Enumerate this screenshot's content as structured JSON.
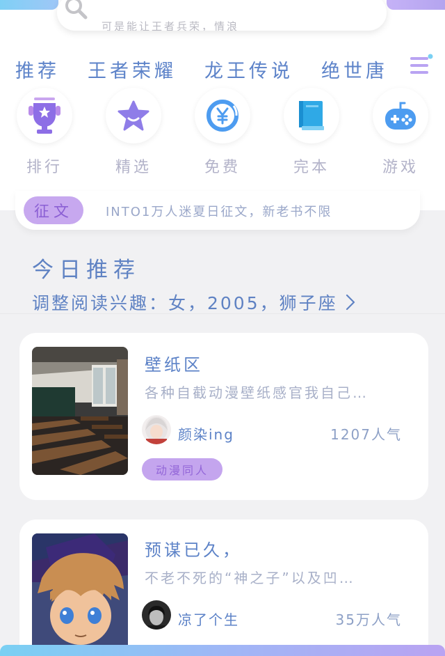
{
  "search": {
    "placeholder": "可是能让王者兵荣，情浪"
  },
  "tabs": [
    "推荐",
    "王者荣耀",
    "龙王传说",
    "绝世唐"
  ],
  "categories": [
    {
      "label": "排行",
      "icon": "trophy-icon"
    },
    {
      "label": "精选",
      "icon": "star-icon"
    },
    {
      "label": "免费",
      "icon": "yen-coin-icon"
    },
    {
      "label": "完本",
      "icon": "book-icon"
    },
    {
      "label": "游戏",
      "icon": "gamepad-icon"
    }
  ],
  "notice": {
    "badge": "征文",
    "text": "INTO1万人迷夏日征文，新老书不限"
  },
  "recommend": {
    "title": "今日推荐",
    "subtitle": "调整阅读兴趣：女，2005，狮子座"
  },
  "books": [
    {
      "title": "壁纸区",
      "description": "各种自截动漫壁纸感官我自己…",
      "author": "颜染ing",
      "popularity": "1207人气",
      "tag": "动漫同人"
    },
    {
      "title": "预谋已久，",
      "description": "不老不死的“神之子”以及凹…",
      "author": "凉了个生",
      "popularity": "35万人气"
    }
  ],
  "colors": {
    "accent_blue": "#5d83c9",
    "accent_purple": "#c4a5ee",
    "icon_blue": "#4d9cf0",
    "icon_purple": "#8d6ee6"
  }
}
